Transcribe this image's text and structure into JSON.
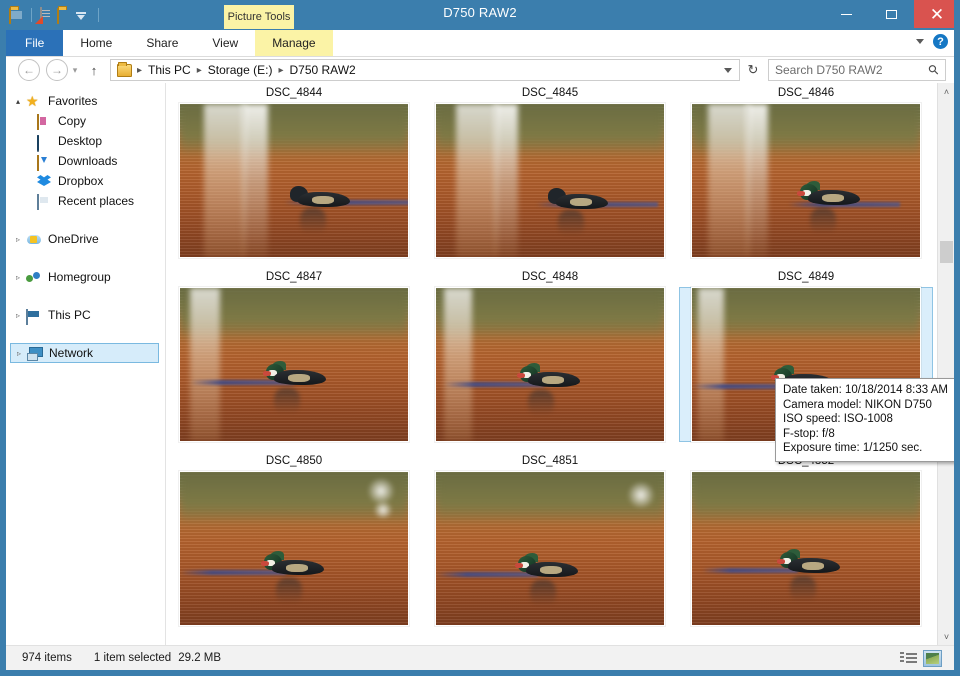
{
  "window": {
    "title": "D750 RAW2",
    "contextual_tab": "Picture Tools",
    "minimize_label": "Minimize",
    "maximize_label": "Maximize",
    "close_label": "Close"
  },
  "quick_access": [
    {
      "name": "folder-icon",
      "label": "Folder"
    },
    {
      "name": "properties-icon",
      "label": "Properties"
    },
    {
      "name": "new-folder-icon",
      "label": "New folder"
    },
    {
      "name": "customize-caret-icon",
      "label": "Customize Quick Access Toolbar"
    }
  ],
  "ribbon": {
    "tabs": [
      {
        "id": "file",
        "label": "File"
      },
      {
        "id": "home",
        "label": "Home"
      },
      {
        "id": "share",
        "label": "Share"
      },
      {
        "id": "view",
        "label": "View"
      },
      {
        "id": "manage",
        "label": "Manage"
      }
    ],
    "collapse_label": "˅",
    "help_label": "?"
  },
  "address_bar": {
    "back_label": "←",
    "forward_label": "→",
    "history_label": "˅",
    "up_label": "↑",
    "refresh_label": "↻",
    "breadcrumbs": [
      "This PC",
      "Storage (E:)",
      "D750 RAW2"
    ],
    "separator": "▸",
    "dropdown_label": "˅"
  },
  "search": {
    "placeholder": "Search D750 RAW2",
    "value": "",
    "icon_label": "⚲"
  },
  "sidebar": {
    "groups": [
      {
        "id": "favorites",
        "label": "Favorites",
        "icon": "star-icon",
        "expander": "▴",
        "expanded": true,
        "children": [
          {
            "label": "Copy",
            "icon": "copy-folder-icon"
          },
          {
            "label": "Desktop",
            "icon": "desktop-icon"
          },
          {
            "label": "Downloads",
            "icon": "downloads-icon"
          },
          {
            "label": "Dropbox",
            "icon": "dropbox-icon"
          },
          {
            "label": "Recent places",
            "icon": "recent-places-icon"
          }
        ]
      },
      {
        "id": "onedrive",
        "label": "OneDrive",
        "icon": "onedrive-icon",
        "expander": "▹",
        "expanded": false,
        "children": []
      },
      {
        "id": "homegroup",
        "label": "Homegroup",
        "icon": "homegroup-icon",
        "expander": "▹",
        "expanded": false,
        "children": []
      },
      {
        "id": "thispc",
        "label": "This PC",
        "icon": "this-pc-icon",
        "expander": "▹",
        "expanded": false,
        "children": []
      },
      {
        "id": "network",
        "label": "Network",
        "icon": "network-icon",
        "expander": "▹",
        "expanded": false,
        "selected": true,
        "children": []
      }
    ]
  },
  "files": {
    "rows": [
      [
        "DSC_4844",
        "DSC_4845",
        "DSC_4846"
      ],
      [
        "DSC_4847",
        "DSC_4848",
        "DSC_4849"
      ],
      [
        "DSC_4850",
        "DSC_4851",
        "DSC_4852"
      ]
    ],
    "selected": "DSC_4852"
  },
  "tooltip": {
    "lines": [
      "Date taken: 10/18/2014 8:33 AM",
      "Camera model: NIKON D750",
      "ISO speed: ISO-1008",
      "F-stop: f/8",
      "Exposure time: 1/1250 sec."
    ],
    "date_taken": "10/18/2014 8:33 AM",
    "camera_model": "NIKON D750",
    "iso_speed": "ISO-1008",
    "f_stop": "f/8",
    "exposure_time": "1/1250 sec."
  },
  "scrollbar": {
    "up_label": "˄",
    "down_label": "˅"
  },
  "status_bar": {
    "item_count": "974 items",
    "selection": "1 item selected",
    "selection_size": "29.2 MB",
    "view_details_label": "Details view",
    "view_large_icons_label": "Large icons view"
  },
  "colors": {
    "title_bar": "#3b7ead",
    "file_tab": "#2b71b8",
    "contextual_tab": "#fbf3a6",
    "close_button": "#d9534f",
    "selection_fill": "#daeefb",
    "selection_border": "#8fc4e4"
  }
}
